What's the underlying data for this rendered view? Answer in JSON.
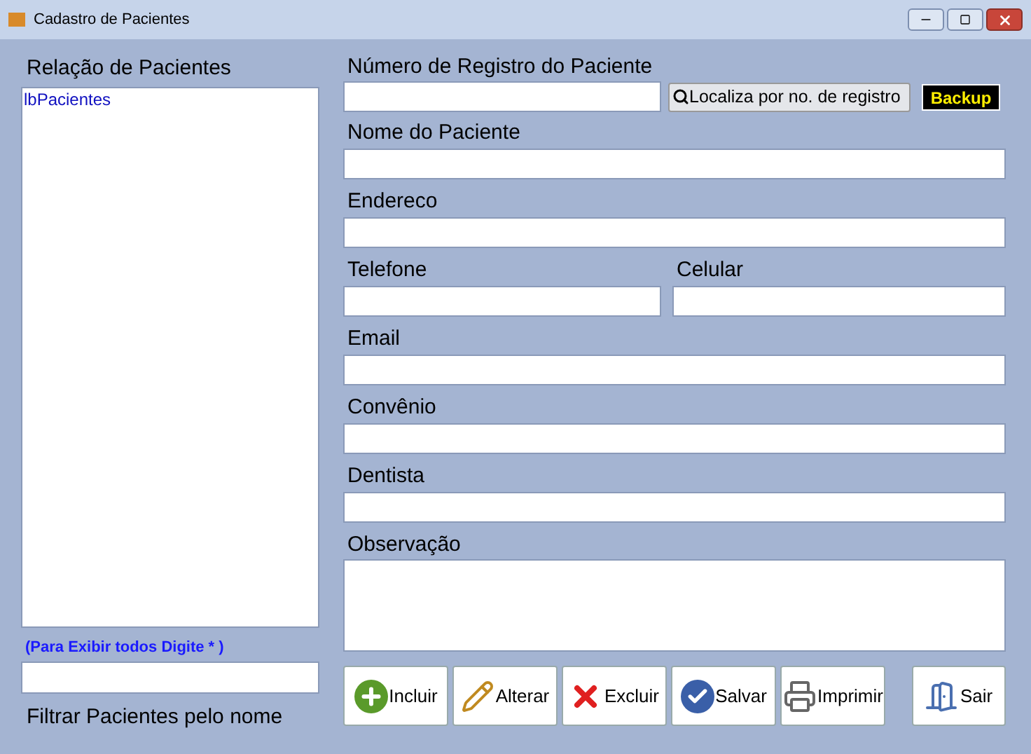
{
  "window": {
    "title": "Cadastro de Pacientes"
  },
  "patient_list": {
    "label": "Relação de Pacientes",
    "items": [
      "lbPacientes"
    ],
    "hint": "(Para Exibir todos Digite * )",
    "filter_label": "Filtrar Pacientes pelo nome"
  },
  "registro": {
    "label": "Número de Registro do Paciente",
    "search_button": "Localiza por no. de registro",
    "backup_button": "Backup"
  },
  "fields": [
    {
      "label": "Nome do Paciente",
      "kind": "single"
    },
    {
      "label": "Endereco",
      "kind": "single"
    },
    {
      "label": "Telefone",
      "kind": "pair",
      "second_label": "Celular"
    },
    {
      "label": "Email",
      "kind": "single"
    },
    {
      "label": "Convênio",
      "kind": "single"
    },
    {
      "label": "Dentista",
      "kind": "single"
    },
    {
      "label": "Observação",
      "kind": "multi"
    }
  ],
  "buttons": [
    {
      "label": "Incluir",
      "kind": "add"
    },
    {
      "label": "Alterar",
      "kind": "edit"
    },
    {
      "label": "Excluir",
      "kind": "delete"
    },
    {
      "label": "Salvar",
      "kind": "save"
    },
    {
      "label": "Imprimir",
      "kind": "print"
    },
    {
      "label": "Sair",
      "kind": "exit"
    }
  ]
}
